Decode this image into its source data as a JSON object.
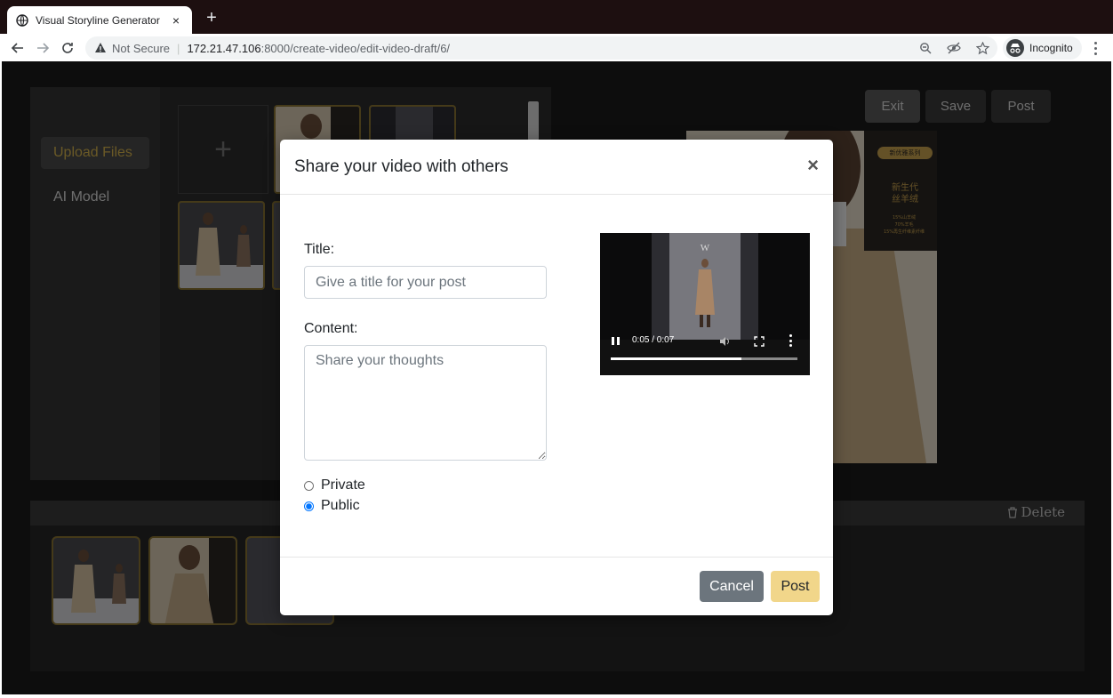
{
  "browser": {
    "tab_title": "Visual Storyline Generator",
    "tab_close": "×",
    "new_tab": "+",
    "security_label": "Not Secure",
    "url_host": "172.21.47.106",
    "url_rest": ":8000/create-video/edit-video-draft/6/",
    "profile_label": "Incognito",
    "icons": [
      "back-icon",
      "forward-icon",
      "reload-icon",
      "warning-icon",
      "zoom-icon",
      "eye-slash-icon",
      "star-icon",
      "incognito-icon",
      "menu-icon"
    ]
  },
  "page": {
    "sidebar": {
      "upload_label": "Upload Files",
      "ai_label": "AI Model"
    },
    "add_icon": "+",
    "actions": {
      "exit_label": "Exit",
      "save_label": "Save",
      "post_label": "Post"
    },
    "preview_overlay": {
      "badge": "新优雅系列",
      "line1": "新生代",
      "line2": "丝羊绒",
      "specs": [
        "15%山羊绒",
        "70%羊毛",
        "15%再生纤维素纤维"
      ]
    },
    "timeline": {
      "delete_label": "Delete"
    }
  },
  "modal": {
    "title": "Share your video with others",
    "close_label": "×",
    "title_label": "Title:",
    "title_placeholder": "Give a title for your post",
    "title_value": "",
    "content_label": "Content:",
    "content_placeholder": "Share your thoughts",
    "content_value": "",
    "visibility": {
      "options": [
        "Private",
        "Public"
      ],
      "selected": "Public"
    },
    "video": {
      "time": "0:05 / 0:07",
      "progress_fraction": 0.7,
      "logo": "W"
    },
    "cancel_label": "Cancel",
    "post_label": "Post"
  }
}
